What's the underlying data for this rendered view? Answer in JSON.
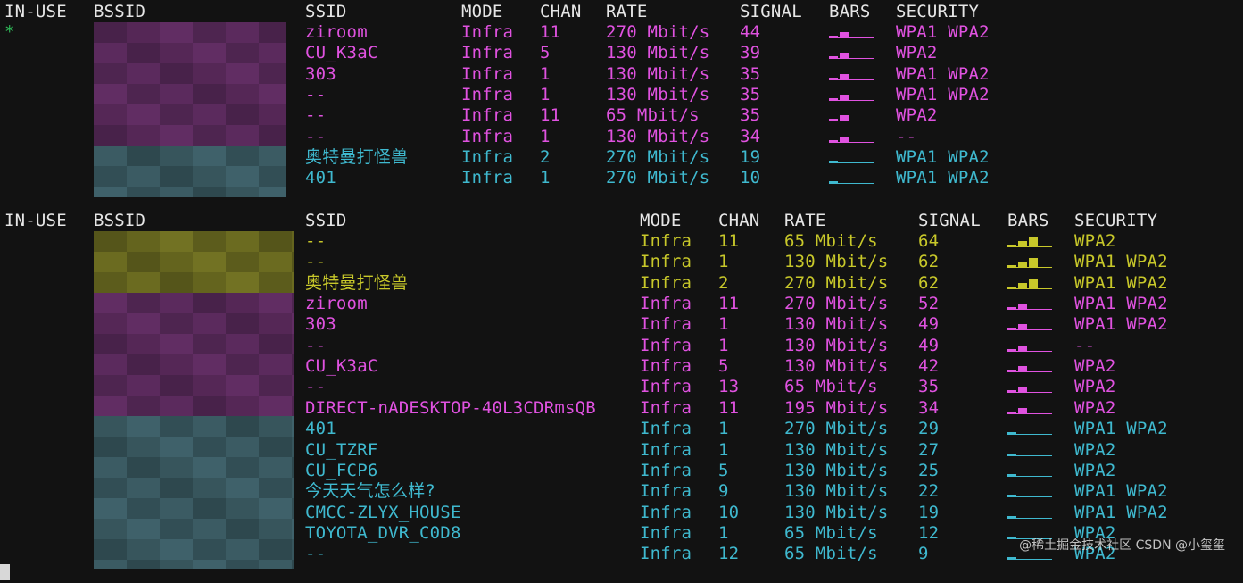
{
  "headers": {
    "in_use": "IN-USE",
    "bssid": "BSSID",
    "ssid": "SSID",
    "mode": "MODE",
    "chan": "CHAN",
    "rate": "RATE",
    "signal": "SIGNAL",
    "bars": "BARS",
    "security": "SECURITY"
  },
  "colors": {
    "background": "#121212",
    "magenta": "#e052e0",
    "cyan": "#3fb9cf",
    "yellow": "#c8c82a",
    "green": "#2fbf5a"
  },
  "scan1": [
    {
      "in_use": "*",
      "ssid": "ziroom",
      "mode": "Infra",
      "chan": "11",
      "rate": "270 Mbit/s",
      "signal": "44",
      "bars": 2,
      "security": "WPA1 WPA2",
      "color": "magenta"
    },
    {
      "in_use": "",
      "ssid": "CU_K3aC",
      "mode": "Infra",
      "chan": "5",
      "rate": "130 Mbit/s",
      "signal": "39",
      "bars": 2,
      "security": "WPA2",
      "color": "magenta"
    },
    {
      "in_use": "",
      "ssid": "303",
      "mode": "Infra",
      "chan": "1",
      "rate": "130 Mbit/s",
      "signal": "35",
      "bars": 2,
      "security": "WPA1 WPA2",
      "color": "magenta"
    },
    {
      "in_use": "",
      "ssid": "--",
      "mode": "Infra",
      "chan": "1",
      "rate": "130 Mbit/s",
      "signal": "35",
      "bars": 2,
      "security": "WPA1 WPA2",
      "color": "magenta"
    },
    {
      "in_use": "",
      "ssid": "--",
      "mode": "Infra",
      "chan": "11",
      "rate": "65 Mbit/s",
      "signal": "35",
      "bars": 2,
      "security": "WPA2",
      "color": "magenta"
    },
    {
      "in_use": "",
      "ssid": "--",
      "mode": "Infra",
      "chan": "1",
      "rate": "130 Mbit/s",
      "signal": "34",
      "bars": 2,
      "security": "--",
      "color": "magenta"
    },
    {
      "in_use": "",
      "ssid": "奥特曼打怪兽",
      "mode": "Infra",
      "chan": "2",
      "rate": "270 Mbit/s",
      "signal": "19",
      "bars": 1,
      "security": "WPA1 WPA2",
      "color": "cyan"
    },
    {
      "in_use": "",
      "ssid": "401",
      "mode": "Infra",
      "chan": "1",
      "rate": "270 Mbit/s",
      "signal": "10",
      "bars": 1,
      "security": "WPA1 WPA2",
      "color": "cyan"
    }
  ],
  "scan2": [
    {
      "ssid": "--",
      "mode": "Infra",
      "chan": "11",
      "rate": "65 Mbit/s",
      "signal": "64",
      "bars": 3,
      "security": "WPA2",
      "color": "yellow"
    },
    {
      "ssid": "--",
      "mode": "Infra",
      "chan": "1",
      "rate": "130 Mbit/s",
      "signal": "62",
      "bars": 3,
      "security": "WPA1 WPA2",
      "color": "yellow"
    },
    {
      "ssid": "奥特曼打怪兽",
      "mode": "Infra",
      "chan": "2",
      "rate": "270 Mbit/s",
      "signal": "62",
      "bars": 3,
      "security": "WPA1 WPA2",
      "color": "yellow"
    },
    {
      "ssid": "ziroom",
      "mode": "Infra",
      "chan": "11",
      "rate": "270 Mbit/s",
      "signal": "52",
      "bars": 2,
      "security": "WPA1 WPA2",
      "color": "magenta"
    },
    {
      "ssid": "303",
      "mode": "Infra",
      "chan": "1",
      "rate": "130 Mbit/s",
      "signal": "49",
      "bars": 2,
      "security": "WPA1 WPA2",
      "color": "magenta"
    },
    {
      "ssid": "--",
      "mode": "Infra",
      "chan": "1",
      "rate": "130 Mbit/s",
      "signal": "49",
      "bars": 2,
      "security": "--",
      "color": "magenta"
    },
    {
      "ssid": "CU_K3aC",
      "mode": "Infra",
      "chan": "5",
      "rate": "130 Mbit/s",
      "signal": "42",
      "bars": 2,
      "security": "WPA2",
      "color": "magenta"
    },
    {
      "ssid": "--",
      "mode": "Infra",
      "chan": "13",
      "rate": "65 Mbit/s",
      "signal": "35",
      "bars": 2,
      "security": "WPA2",
      "color": "magenta"
    },
    {
      "ssid": "DIRECT-nADESKTOP-40L3CDRmsQB",
      "mode": "Infra",
      "chan": "11",
      "rate": "195 Mbit/s",
      "signal": "34",
      "bars": 2,
      "security": "WPA2",
      "color": "magenta"
    },
    {
      "ssid": "401",
      "mode": "Infra",
      "chan": "1",
      "rate": "270 Mbit/s",
      "signal": "29",
      "bars": 1,
      "security": "WPA1 WPA2",
      "color": "cyan"
    },
    {
      "ssid": "CU_TZRF",
      "mode": "Infra",
      "chan": "1",
      "rate": "130 Mbit/s",
      "signal": "27",
      "bars": 1,
      "security": "WPA2",
      "color": "cyan"
    },
    {
      "ssid": "CU_FCP6",
      "mode": "Infra",
      "chan": "5",
      "rate": "130 Mbit/s",
      "signal": "25",
      "bars": 1,
      "security": "WPA2",
      "color": "cyan"
    },
    {
      "ssid": "今天天气怎么样?",
      "mode": "Infra",
      "chan": "9",
      "rate": "130 Mbit/s",
      "signal": "22",
      "bars": 1,
      "security": "WPA1 WPA2",
      "color": "cyan"
    },
    {
      "ssid": "CMCC-ZLYX_HOUSE",
      "mode": "Infra",
      "chan": "10",
      "rate": "130 Mbit/s",
      "signal": "19",
      "bars": 1,
      "security": "WPA1 WPA2",
      "color": "cyan"
    },
    {
      "ssid": "TOYOTA_DVR_C0D8",
      "mode": "Infra",
      "chan": "1",
      "rate": "65 Mbit/s",
      "signal": "12",
      "bars": 1,
      "security": "WPA2",
      "color": "cyan"
    },
    {
      "ssid": "--",
      "mode": "Infra",
      "chan": "12",
      "rate": "65 Mbit/s",
      "signal": "9",
      "bars": 1,
      "security": "WPA2",
      "color": "cyan"
    }
  ],
  "watermark": "@稀土掘金技术社区 CSDN @小玺玺"
}
